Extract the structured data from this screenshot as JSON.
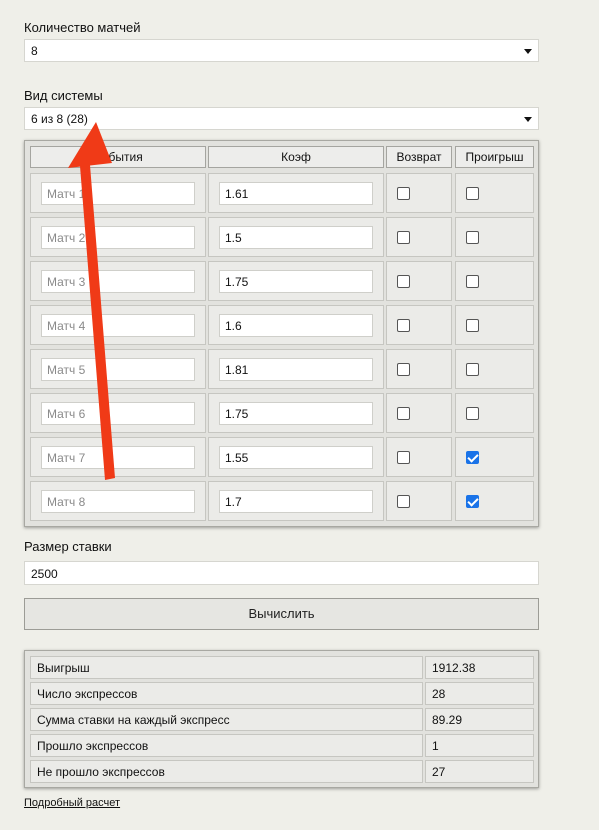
{
  "matches_count": {
    "label": "Количество матчей",
    "value": "8"
  },
  "system_type": {
    "label": "Вид системы",
    "value": "6 из 8 (28)"
  },
  "table": {
    "headers": {
      "event": "События",
      "coef": "Коэф",
      "refund": "Возврат",
      "loss": "Проигрыш"
    },
    "rows": [
      {
        "event_placeholder": "Матч 1",
        "coef": "1.61",
        "refund": false,
        "loss": false
      },
      {
        "event_placeholder": "Матч 2",
        "coef": "1.5",
        "refund": false,
        "loss": false
      },
      {
        "event_placeholder": "Матч 3",
        "coef": "1.75",
        "refund": false,
        "loss": false
      },
      {
        "event_placeholder": "Матч 4",
        "coef": "1.6",
        "refund": false,
        "loss": false
      },
      {
        "event_placeholder": "Матч 5",
        "coef": "1.81",
        "refund": false,
        "loss": false
      },
      {
        "event_placeholder": "Матч 6",
        "coef": "1.75",
        "refund": false,
        "loss": false
      },
      {
        "event_placeholder": "Матч 7",
        "coef": "1.55",
        "refund": false,
        "loss": true
      },
      {
        "event_placeholder": "Матч 8",
        "coef": "1.7",
        "refund": false,
        "loss": true
      }
    ]
  },
  "stake": {
    "label": "Размер ставки",
    "value": "2500"
  },
  "calculate_button": "Вычислить",
  "results": [
    {
      "label": "Выигрыш",
      "value": "1912.38"
    },
    {
      "label": "Число экспрессов",
      "value": "28"
    },
    {
      "label": "Сумма ставки на каждый экспресс",
      "value": "89.29"
    },
    {
      "label": "Прошло экспрессов",
      "value": "1"
    },
    {
      "label": "Не прошло экспрессов",
      "value": "27"
    }
  ],
  "details_link": "Подробный расчет",
  "colors": {
    "annotation_arrow": "#f03a17",
    "checkbox_checked": "#1a73e8"
  },
  "annotation": {
    "icon": "red-arrow-icon"
  }
}
